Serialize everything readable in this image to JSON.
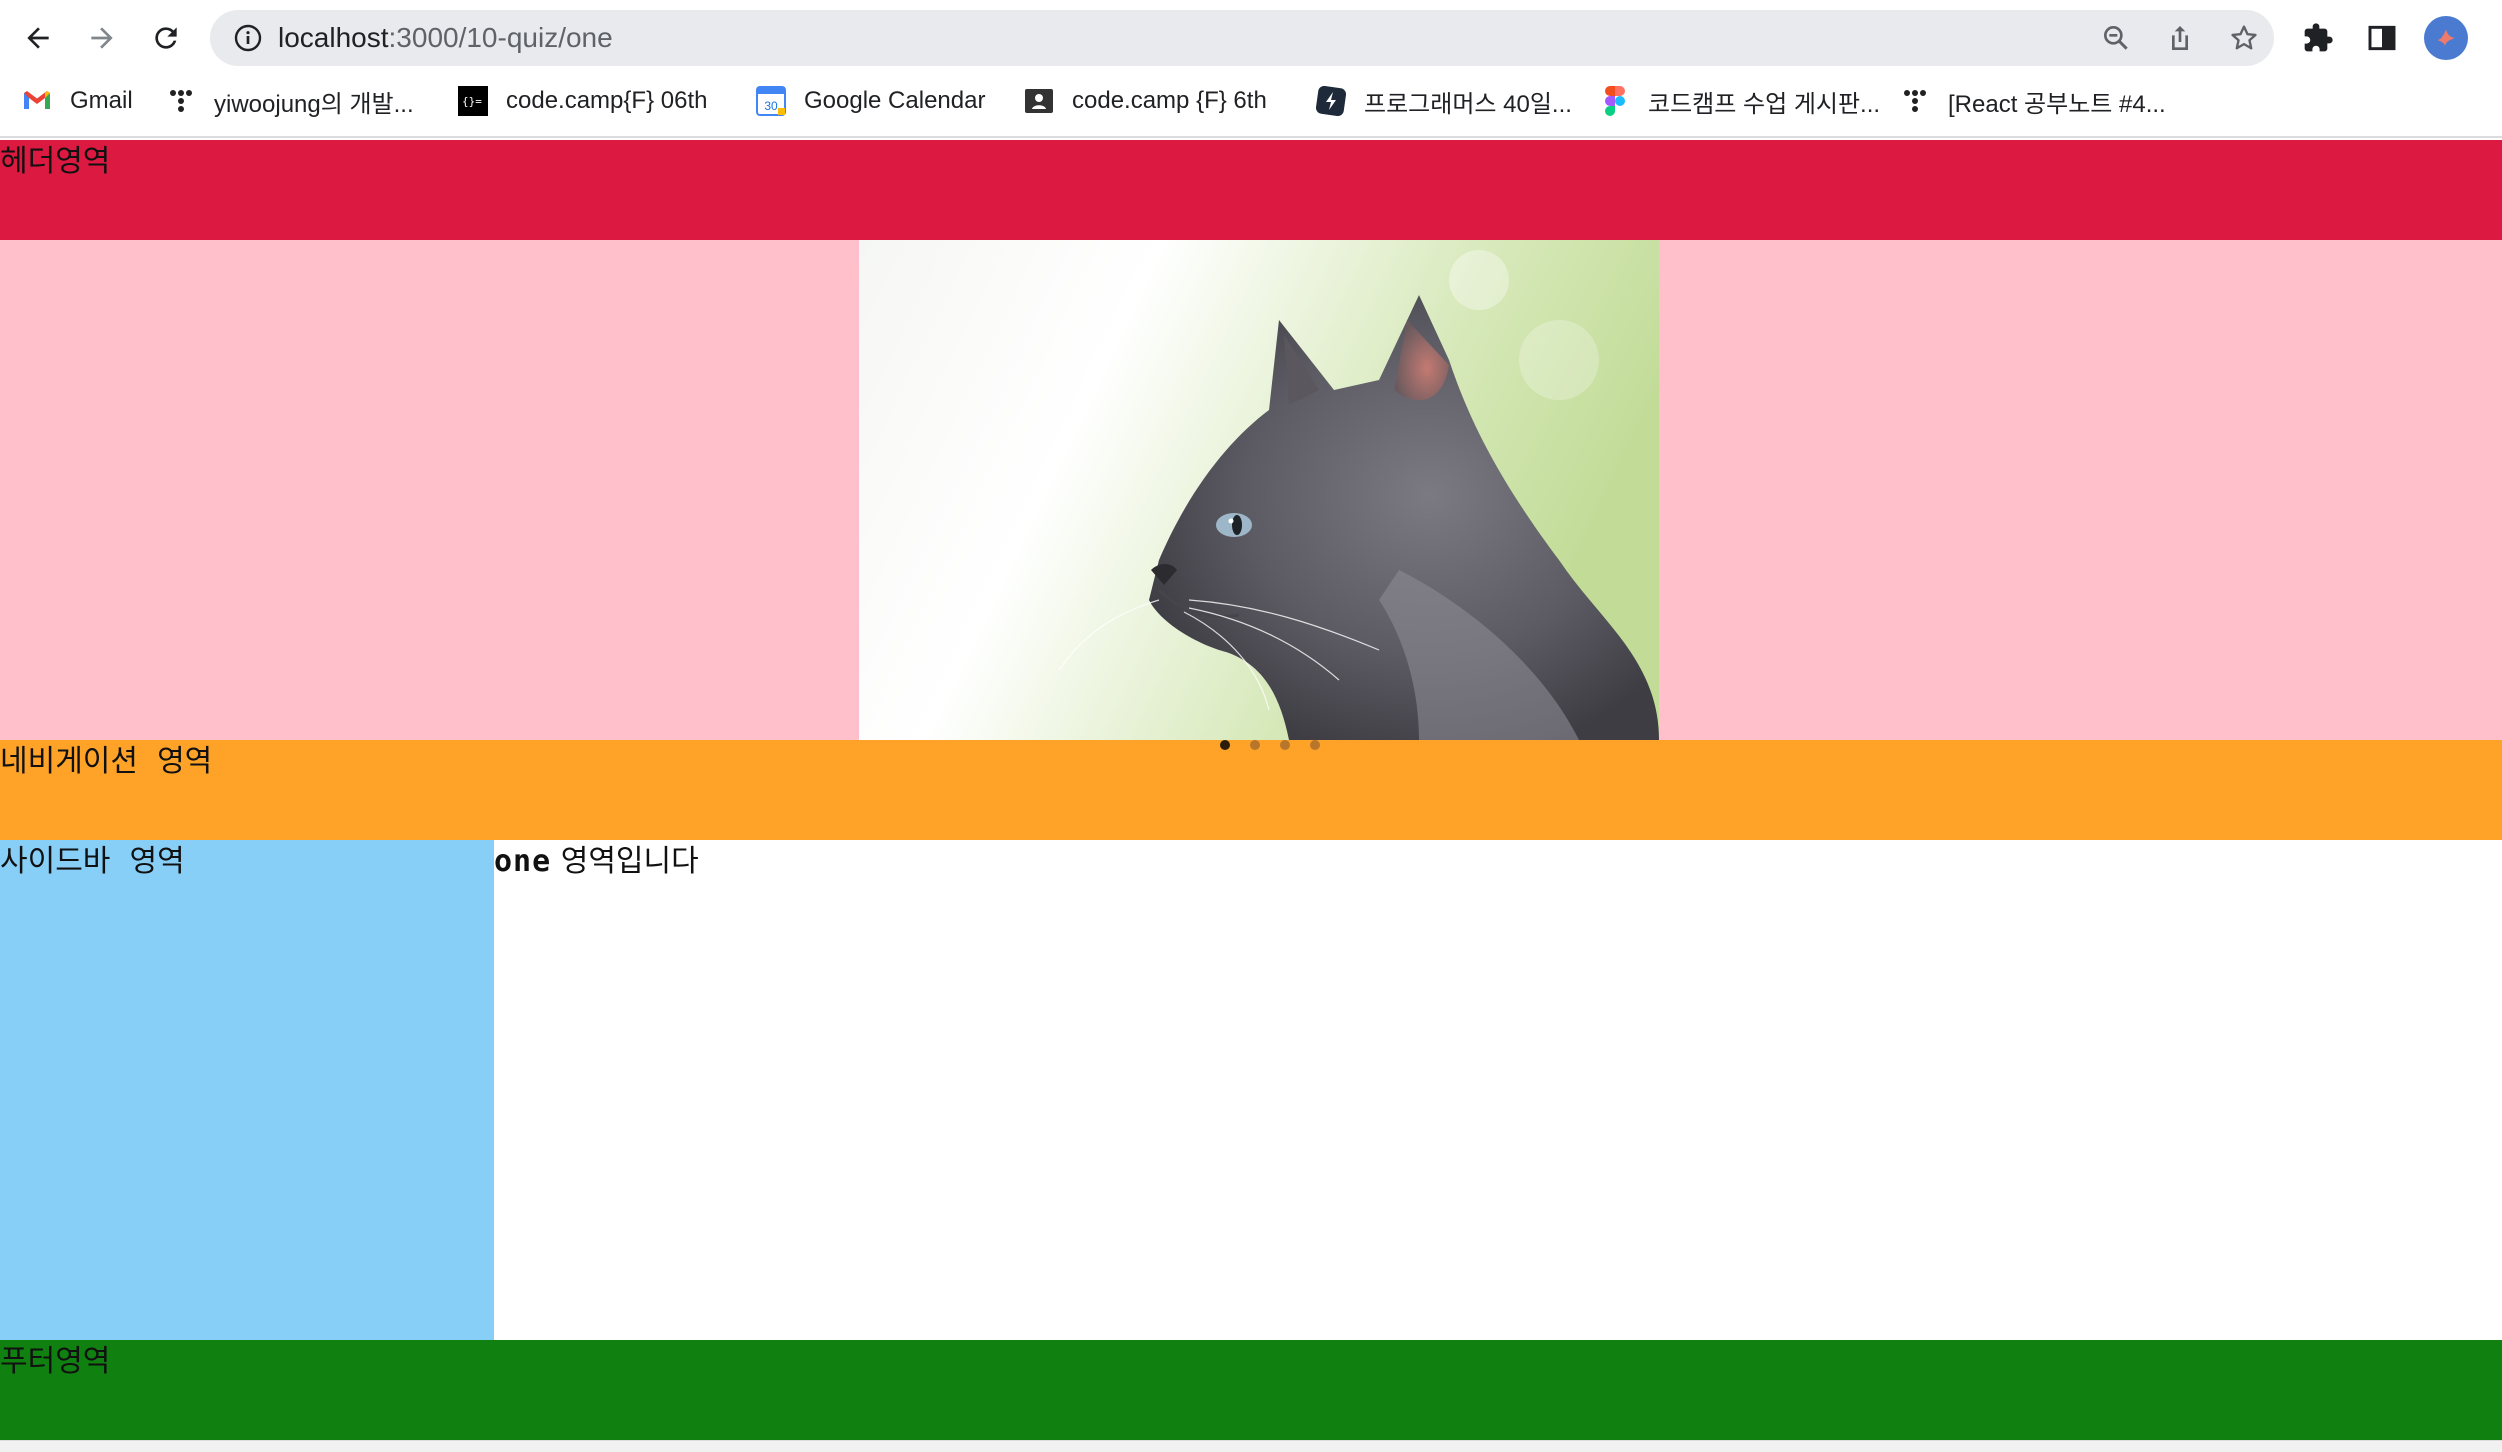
{
  "browser": {
    "url_host": "localhost",
    "url_path": ":3000/10-quiz/one",
    "bookmarks": [
      {
        "label": "Gmail",
        "icon": "gmail-icon"
      },
      {
        "label": "yiwoojung의 개발...",
        "icon": "velog-dots-icon"
      },
      {
        "label": "code.camp{F} 06th",
        "icon": "codecamp-icon"
      },
      {
        "label": "Google Calendar",
        "icon": "google-calendar-icon",
        "icon_text": "30"
      },
      {
        "label": "code.camp {F} 6th",
        "icon": "classroom-icon"
      },
      {
        "label": "프로그래머스 40일...",
        "icon": "programmers-icon"
      },
      {
        "label": "코드캠프 수업 게시판...",
        "icon": "figma-icon"
      },
      {
        "label": "[React 공부노트 #4...",
        "icon": "velog-dots-icon"
      }
    ]
  },
  "page": {
    "header_label": "헤더영역",
    "navigation_label": "네비게이션  영역",
    "sidebar_label": "사이드바  영역",
    "main_keyword": "one",
    "main_suffix": " 영역입니다",
    "footer_label": "푸터영역",
    "slider": {
      "slide_count": 4,
      "active_index": 0,
      "image": "gray cat profile photo"
    }
  },
  "colors": {
    "header": "#dc1941",
    "banner": "#ffc0cb",
    "navigation": "#ffa328",
    "sidebar": "#88cff8",
    "footer": "#108010"
  }
}
